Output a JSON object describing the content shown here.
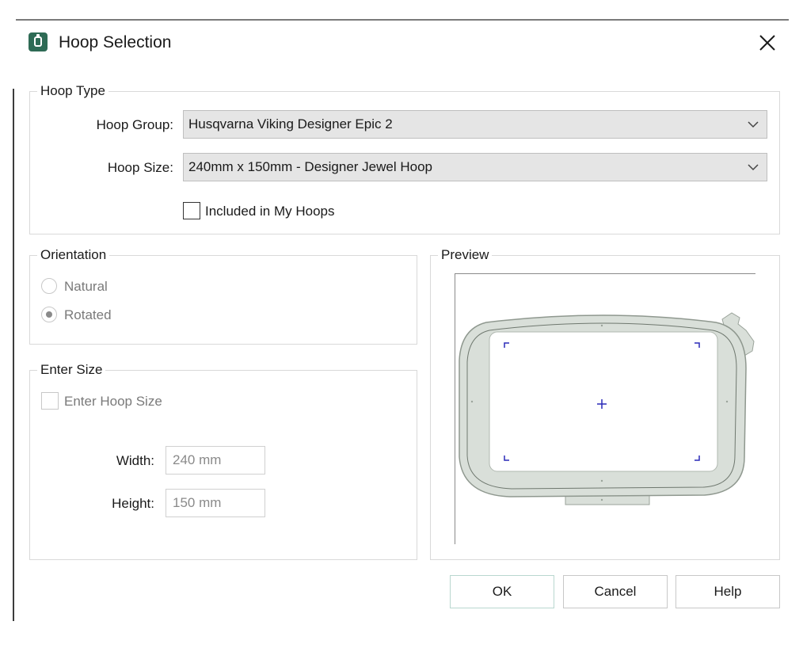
{
  "window": {
    "title": "Hoop Selection",
    "close_icon": "close-icon",
    "app_icon": "hoop-app-icon"
  },
  "hoop_type": {
    "legend": "Hoop Type",
    "hoop_group": {
      "label": "Hoop Group:",
      "value": "Husqvarna Viking Designer Epic 2"
    },
    "hoop_size": {
      "label": "Hoop Size:",
      "value": "240mm x 150mm - Designer Jewel Hoop"
    },
    "included_in_my_hoops": {
      "label": "Included in My Hoops",
      "checked": false
    }
  },
  "orientation": {
    "legend": "Orientation",
    "options": [
      {
        "label": "Natural",
        "selected": false
      },
      {
        "label": "Rotated",
        "selected": true
      }
    ]
  },
  "enter_size": {
    "legend": "Enter Size",
    "enter_hoop_size": {
      "label": "Enter Hoop Size",
      "checked": false
    },
    "width": {
      "label": "Width:",
      "value": "240 mm"
    },
    "height": {
      "label": "Height:",
      "value": "150 mm"
    }
  },
  "preview": {
    "legend": "Preview",
    "colors": {
      "hoop": "#d9dfd9",
      "marks": "#2a2ab8"
    }
  },
  "buttons": {
    "ok": "OK",
    "cancel": "Cancel",
    "help": "Help"
  }
}
